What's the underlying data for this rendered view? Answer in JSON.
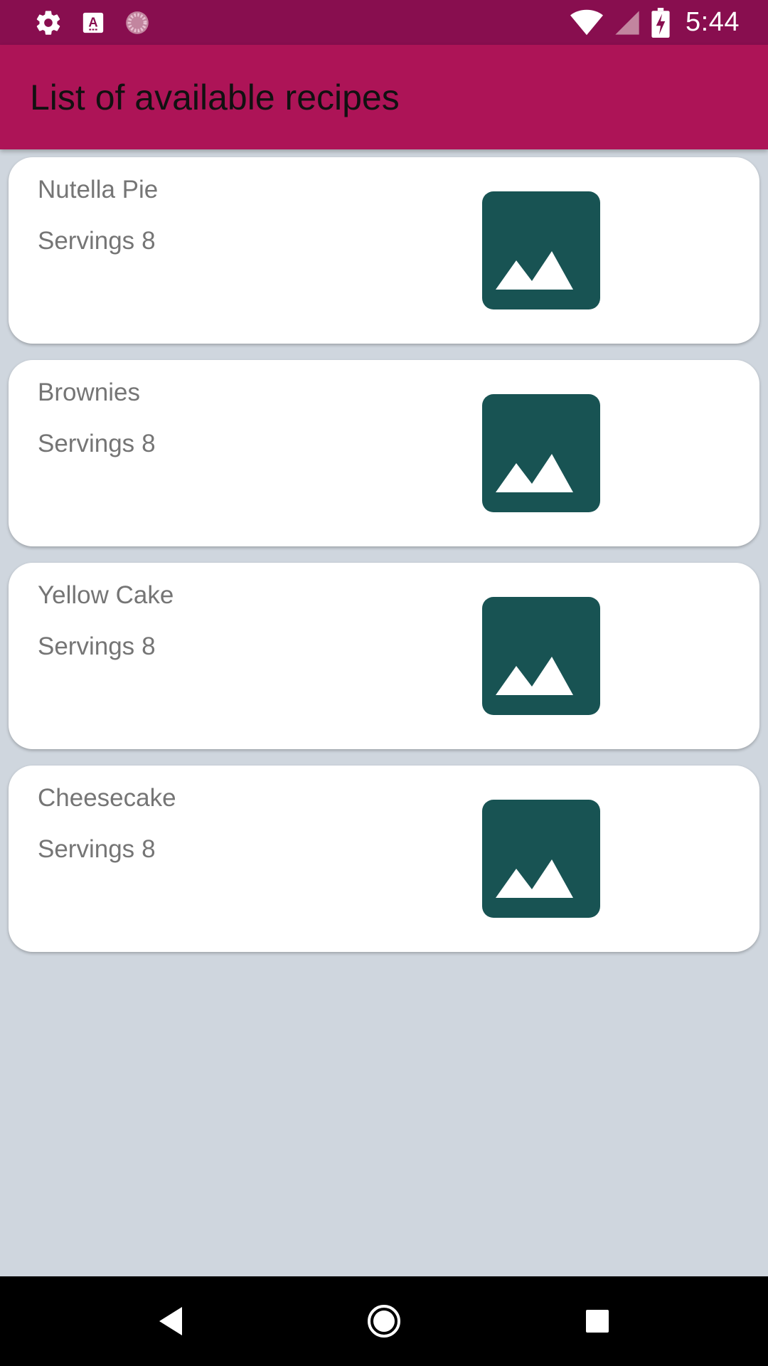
{
  "status_bar": {
    "time": "5:44",
    "icons_left": [
      "settings-icon",
      "keyboard-a-icon",
      "loading-spinner-icon"
    ],
    "icons_right": [
      "wifi-icon",
      "cell-signal-icon",
      "battery-charging-icon"
    ]
  },
  "app_bar": {
    "title": "List of available recipes"
  },
  "recipes": [
    {
      "name": "Nutella Pie",
      "servings_label": "Servings",
      "servings": "8",
      "image": "image-placeholder-icon"
    },
    {
      "name": "Brownies",
      "servings_label": "Servings",
      "servings": "8",
      "image": "image-placeholder-icon"
    },
    {
      "name": "Yellow Cake",
      "servings_label": "Servings",
      "servings": "8",
      "image": "image-placeholder-icon"
    },
    {
      "name": "Cheesecake",
      "servings_label": "Servings",
      "servings": "8",
      "image": "image-placeholder-icon"
    }
  ],
  "nav_bar": {
    "buttons": [
      "back-icon",
      "home-icon",
      "recents-icon"
    ]
  },
  "colors": {
    "status_bar": "#880e4f",
    "app_bar": "#ad1457",
    "background": "#cfd6de",
    "card": "#ffffff",
    "thumbnail": "#185353",
    "text_secondary": "#757575"
  }
}
